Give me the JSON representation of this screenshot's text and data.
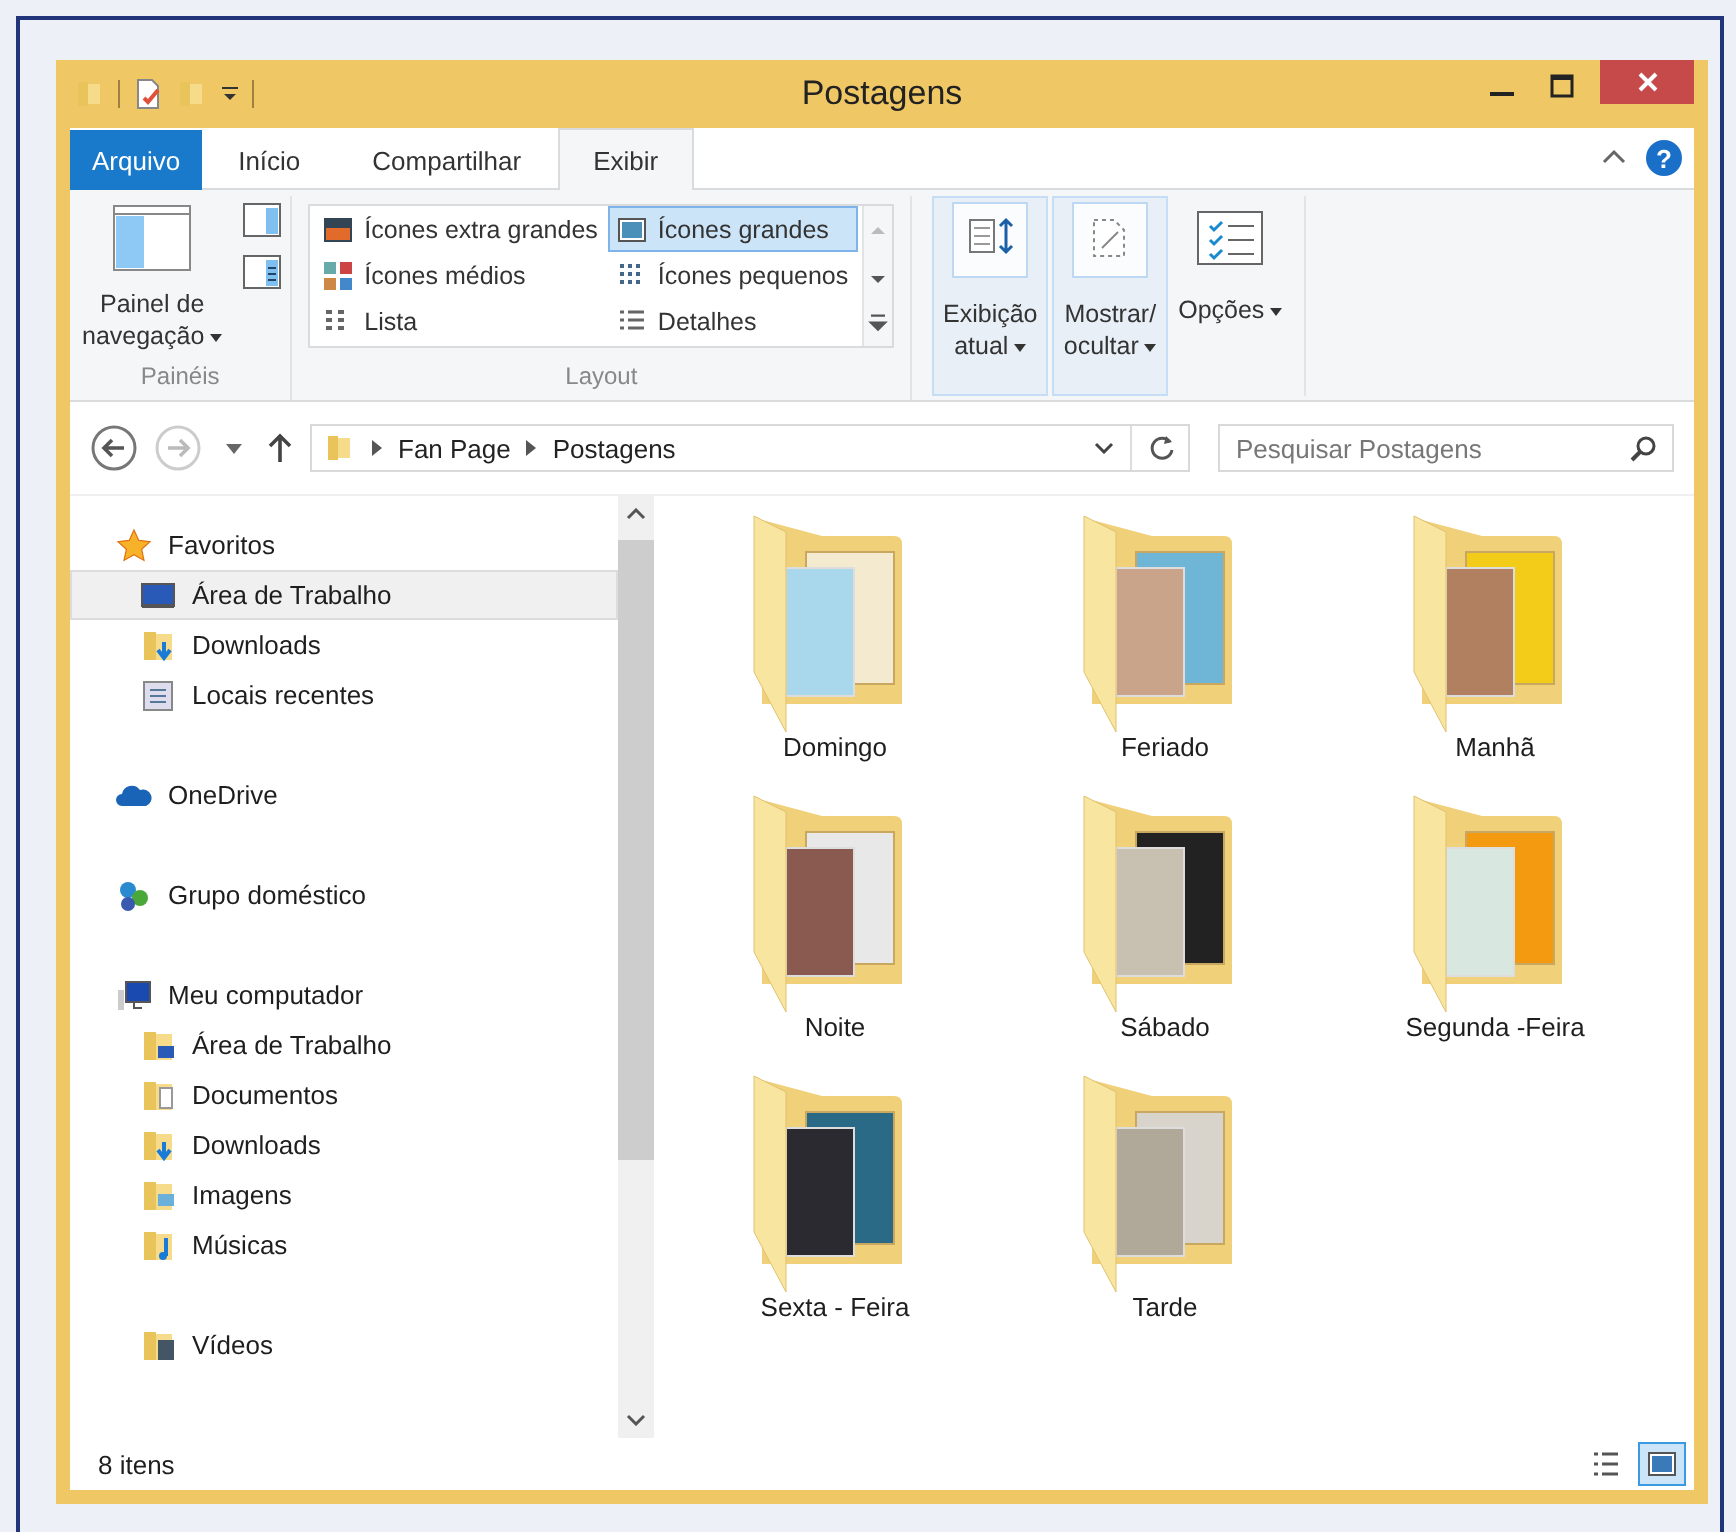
{
  "window": {
    "title": "Postagens"
  },
  "ribbon_tabs": [
    {
      "label": "Arquivo",
      "kind": "file",
      "selected": false
    },
    {
      "label": "Início",
      "kind": "tab",
      "selected": false
    },
    {
      "label": "Compartilhar",
      "kind": "tab",
      "selected": false
    },
    {
      "label": "Exibir",
      "kind": "tab",
      "selected": true
    }
  ],
  "help_button": "?",
  "ribbon": {
    "panes_group": {
      "label": "Painéis",
      "button": "Painel de\nnavegação"
    },
    "layout_group": {
      "label": "Layout",
      "options": [
        {
          "label": "Ícones extra grandes",
          "selected": false
        },
        {
          "label": "Ícones grandes",
          "selected": true
        },
        {
          "label": "Ícones médios",
          "selected": false
        },
        {
          "label": "Ícones pequenos",
          "selected": false
        },
        {
          "label": "Lista",
          "selected": false
        },
        {
          "label": "Detalhes",
          "selected": false
        }
      ]
    },
    "big_buttons": [
      {
        "label": "Exibição\natual",
        "highlighted": true
      },
      {
        "label": "Mostrar/\nocultar",
        "highlighted": true
      },
      {
        "label": "Opções",
        "highlighted": false
      }
    ]
  },
  "address_bar": {
    "crumbs": [
      "Fan Page",
      "Postagens"
    ],
    "search_placeholder": "Pesquisar Postagens"
  },
  "sidebar": {
    "groups": [
      {
        "label": "Favoritos",
        "selected": false,
        "children": [
          {
            "label": "Área de Trabalho",
            "selected": true
          },
          {
            "label": "Downloads",
            "selected": false
          },
          {
            "label": "Locais recentes",
            "selected": false
          }
        ]
      },
      {
        "label": "OneDrive",
        "selected": false
      },
      {
        "label": "Grupo doméstico",
        "selected": false
      },
      {
        "label": "Meu computador",
        "selected": false,
        "children": [
          {
            "label": "Área de Trabalho",
            "selected": false
          },
          {
            "label": "Documentos",
            "selected": false
          },
          {
            "label": "Downloads",
            "selected": false
          },
          {
            "label": "Imagens",
            "selected": false
          },
          {
            "label": "Músicas",
            "selected": false
          },
          {
            "label": "Vídeos",
            "selected": false
          }
        ]
      }
    ]
  },
  "folders": [
    {
      "name": "Domingo"
    },
    {
      "name": "Feriado"
    },
    {
      "name": "Manhã"
    },
    {
      "name": "Noite"
    },
    {
      "name": "Sábado"
    },
    {
      "name": "Segunda -Feira"
    },
    {
      "name": "Sexta - Feira"
    },
    {
      "name": "Tarde"
    }
  ],
  "status_bar": {
    "count": "8 itens",
    "views": [
      {
        "selected": false
      },
      {
        "selected": true
      }
    ]
  }
}
